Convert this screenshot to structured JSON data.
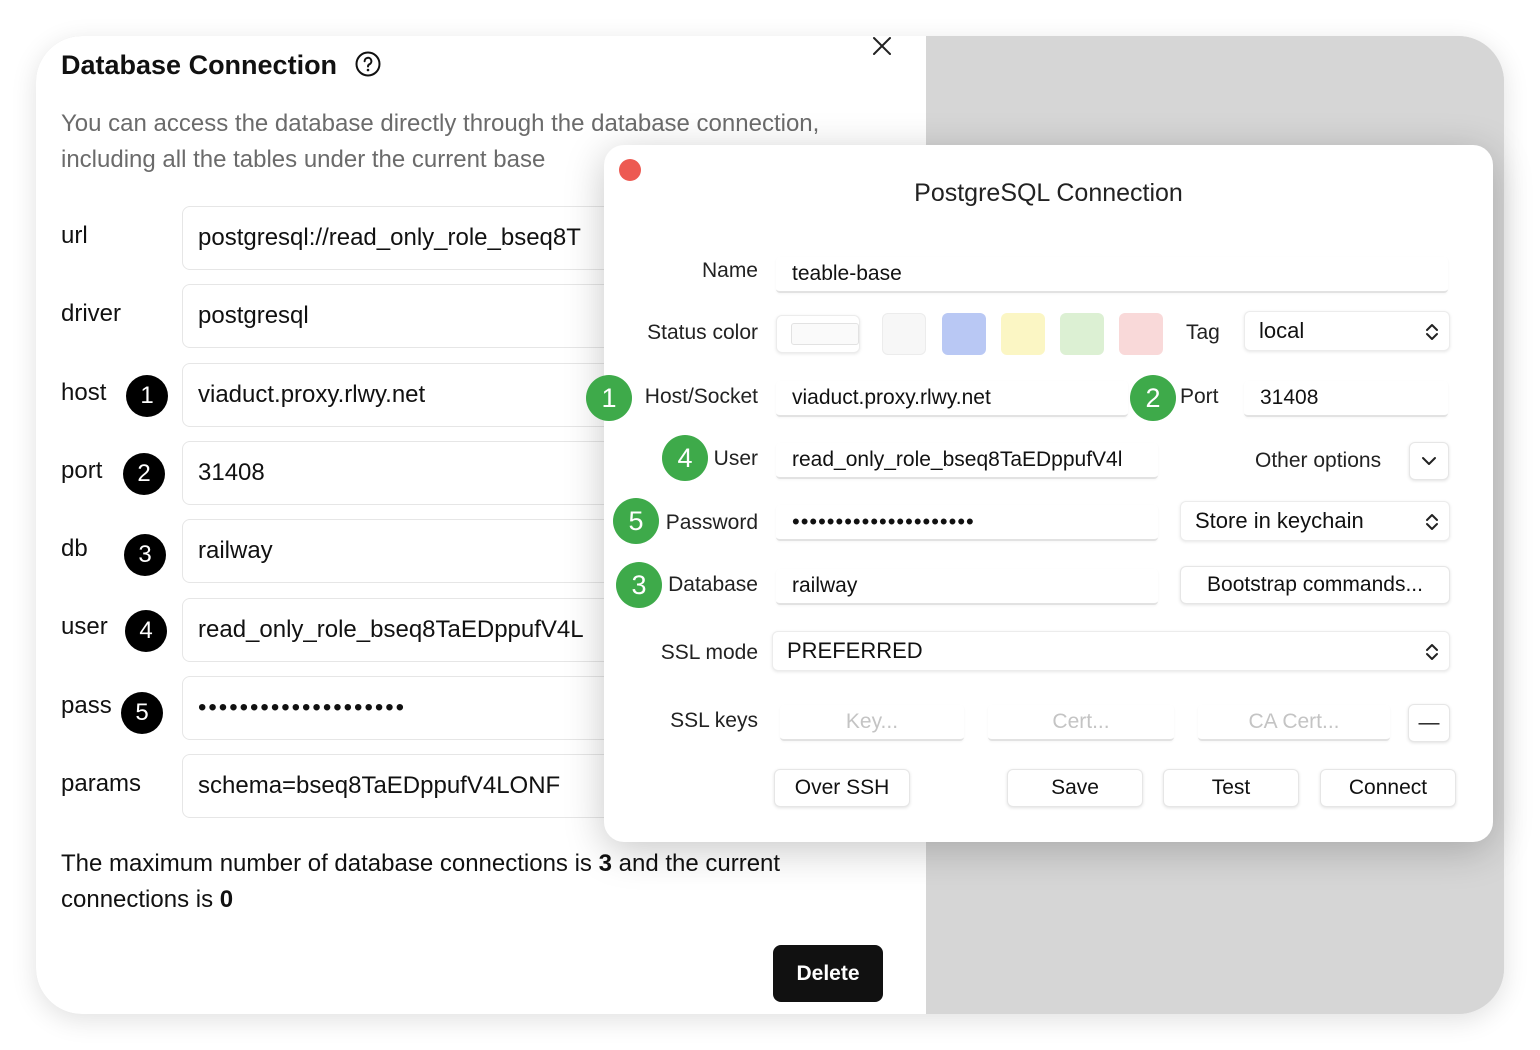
{
  "left_panel": {
    "title": "Database Connection",
    "description": "You can access the database directly through the database connection, including all the tables under the current base",
    "fields": [
      {
        "label": "url",
        "value": "postgresql://read_only_role_bseq8T",
        "badge": ""
      },
      {
        "label": "driver",
        "value": "postgresql",
        "badge": ""
      },
      {
        "label": "host",
        "value": "viaduct.proxy.rlwy.net",
        "badge": "1"
      },
      {
        "label": "port",
        "value": "31408",
        "badge": "2"
      },
      {
        "label": "db",
        "value": "railway",
        "badge": "3"
      },
      {
        "label": "user",
        "value": "read_only_role_bseq8TaEDppufV4L",
        "badge": "4"
      },
      {
        "label": "pass",
        "value": "••••••••••••••••••••",
        "badge": "5"
      },
      {
        "label": "params",
        "value": "schema=bseq8TaEDppufV4LONF",
        "badge": ""
      }
    ],
    "footer": {
      "text1": "The maximum number of database connections is ",
      "max_connections": "3",
      "text2": " and the current connections is ",
      "current_connections": "0"
    },
    "delete_label": "Delete"
  },
  "dialog": {
    "title": "PostgreSQL Connection",
    "name_label": "Name",
    "name_value": "teable-base",
    "status_color_label": "Status color",
    "status_colors": [
      "#f7f7f7",
      "#b9c8f4",
      "#fbf6c4",
      "#dcf0d3",
      "#f9d9d9"
    ],
    "tag_label": "Tag",
    "tag_value": "local",
    "host_label": "Host/Socket",
    "host_value": "viaduct.proxy.rlwy.net",
    "port_label": "Port",
    "port_value": "31408",
    "user_label": "User",
    "user_value": "read_only_role_bseq8TaEDppufV4l",
    "other_options_label": "Other options",
    "password_label": "Password",
    "password_value": "•••••••••••••••••••••",
    "password_store": "Store in keychain",
    "database_label": "Database",
    "database_value": "railway",
    "bootstrap_label": "Bootstrap commands...",
    "ssl_mode_label": "SSL mode",
    "ssl_mode_value": "PREFERRED",
    "ssl_keys_label": "SSL keys",
    "key_placeholder": "Key...",
    "cert_placeholder": "Cert...",
    "ca_cert_placeholder": "CA Cert...",
    "minus_label": "—",
    "over_ssh_label": "Over SSH",
    "save_label": "Save",
    "test_label": "Test",
    "connect_label": "Connect",
    "badges": {
      "host": "1",
      "port": "2",
      "user": "4",
      "password": "5",
      "database": "3"
    }
  },
  "icons": {
    "help": "help-circle-icon",
    "close": "close-icon",
    "window_close": "window-close-dot-icon",
    "updown": "chevron-updown-icon",
    "chevron_down": "chevron-down-icon"
  },
  "colors": {
    "badge_green": "#3eaa4a",
    "badge_black": "#000000",
    "traffic_red": "#ed5a52",
    "delete_bg": "#111111"
  }
}
